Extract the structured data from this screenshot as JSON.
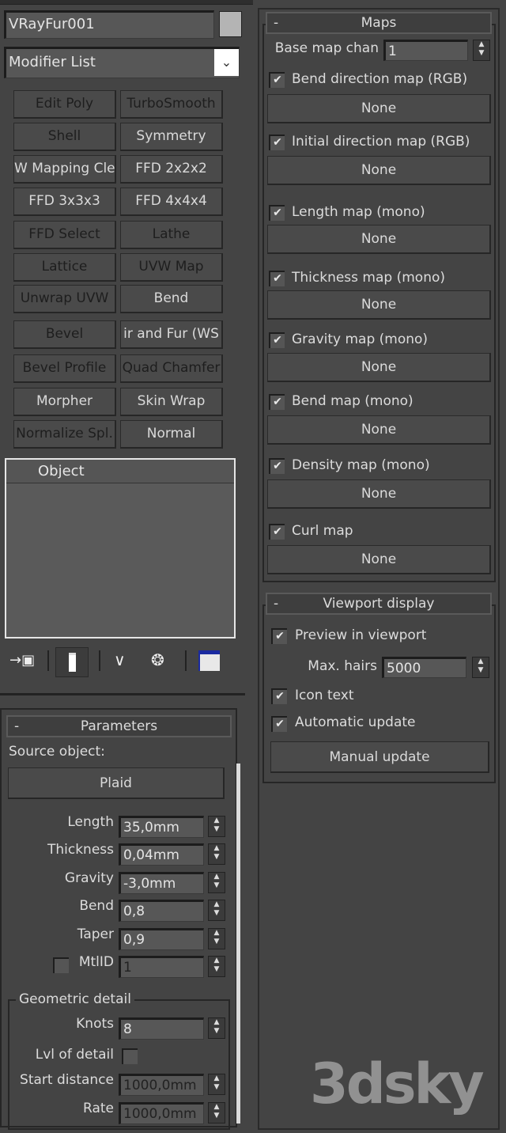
{
  "object_name": "VRayFur001",
  "object_color": "#b4b4b4",
  "modifier_list": {
    "label": "Modifier List",
    "icon": "chevron-down-icon"
  },
  "modifier_buttons": [
    {
      "label": "Edit Poly",
      "dark": true
    },
    {
      "label": "TurboSmooth",
      "dark": true
    },
    {
      "label": "Shell",
      "dark": true
    },
    {
      "label": "Symmetry",
      "dark": false
    },
    {
      "label": "W Mapping Cle",
      "dark": false
    },
    {
      "label": "FFD 2x2x2",
      "dark": false
    },
    {
      "label": "FFD 3x3x3",
      "dark": false
    },
    {
      "label": "FFD 4x4x4",
      "dark": false
    },
    {
      "label": "FFD Select",
      "dark": true
    },
    {
      "label": "Lathe",
      "dark": true
    },
    {
      "label": "Lattice",
      "dark": true
    },
    {
      "label": "UVW Map",
      "dark": true
    },
    {
      "label": "Unwrap UVW",
      "dark": true
    },
    {
      "label": "Bend",
      "dark": false
    },
    {
      "label": "Bevel",
      "dark": true
    },
    {
      "label": "ir and Fur (WS",
      "dark": false
    },
    {
      "label": "Bevel Profile",
      "dark": true
    },
    {
      "label": "Quad Chamfer",
      "dark": true
    },
    {
      "label": "Morpher",
      "dark": false
    },
    {
      "label": "Skin Wrap",
      "dark": false
    },
    {
      "label": "Normalize Spl.",
      "dark": true
    },
    {
      "label": "Normal",
      "dark": false
    }
  ],
  "stack": {
    "items": [
      "Object"
    ]
  },
  "stack_tools": [
    "pin-stack-icon",
    "show-end-result-icon",
    "make-unique-icon",
    "remove-modifier-icon",
    "configure-modifier-sets-icon"
  ],
  "parameters": {
    "title": "Parameters",
    "collapse": "-",
    "source_label": "Source object:",
    "source_value": "Plaid",
    "fields": [
      {
        "label": "Length",
        "value": "35,0mm"
      },
      {
        "label": "Thickness",
        "value": "0,04mm"
      },
      {
        "label": "Gravity",
        "value": "-3,0mm"
      },
      {
        "label": "Bend",
        "value": "0,8"
      },
      {
        "label": "Taper",
        "value": "0,9"
      },
      {
        "label": "MtlID",
        "value": "1",
        "checkbox": false,
        "disabled": true
      }
    ],
    "geometric": {
      "title": "Geometric detail",
      "knots_label": "Knots",
      "knots": "8",
      "lod_label": "Lvl of detail",
      "lod": false,
      "start_label": "Start distance",
      "start": "1000,0mm",
      "rate_label": "Rate",
      "rate": "1000,0mm"
    }
  },
  "maps": {
    "title": "Maps",
    "collapse": "-",
    "base_label": "Base map chan",
    "base_value": "1",
    "items": [
      {
        "label": "Bend direction map (RGB)",
        "checked": true,
        "map": "None"
      },
      {
        "label": "Initial direction map (RGB)",
        "checked": true,
        "map": "None"
      },
      {
        "label": "Length map (mono)",
        "checked": true,
        "map": "None"
      },
      {
        "label": "Thickness map (mono)",
        "checked": true,
        "map": "None"
      },
      {
        "label": "Gravity map (mono)",
        "checked": true,
        "map": "None"
      },
      {
        "label": "Bend map (mono)",
        "checked": true,
        "map": "None"
      },
      {
        "label": "Density map (mono)",
        "checked": true,
        "map": "None"
      },
      {
        "label": "Curl map",
        "checked": true,
        "map": "None"
      }
    ]
  },
  "viewport": {
    "title": "Viewport display",
    "collapse": "-",
    "preview_label": "Preview in viewport",
    "preview": true,
    "max_hairs_label": "Max. hairs",
    "max_hairs": "5000",
    "icon_text_label": "Icon text",
    "icon_text": true,
    "auto_update_label": "Automatic update",
    "auto_update": true,
    "manual_update": "Manual update"
  },
  "watermark": "3dsky"
}
